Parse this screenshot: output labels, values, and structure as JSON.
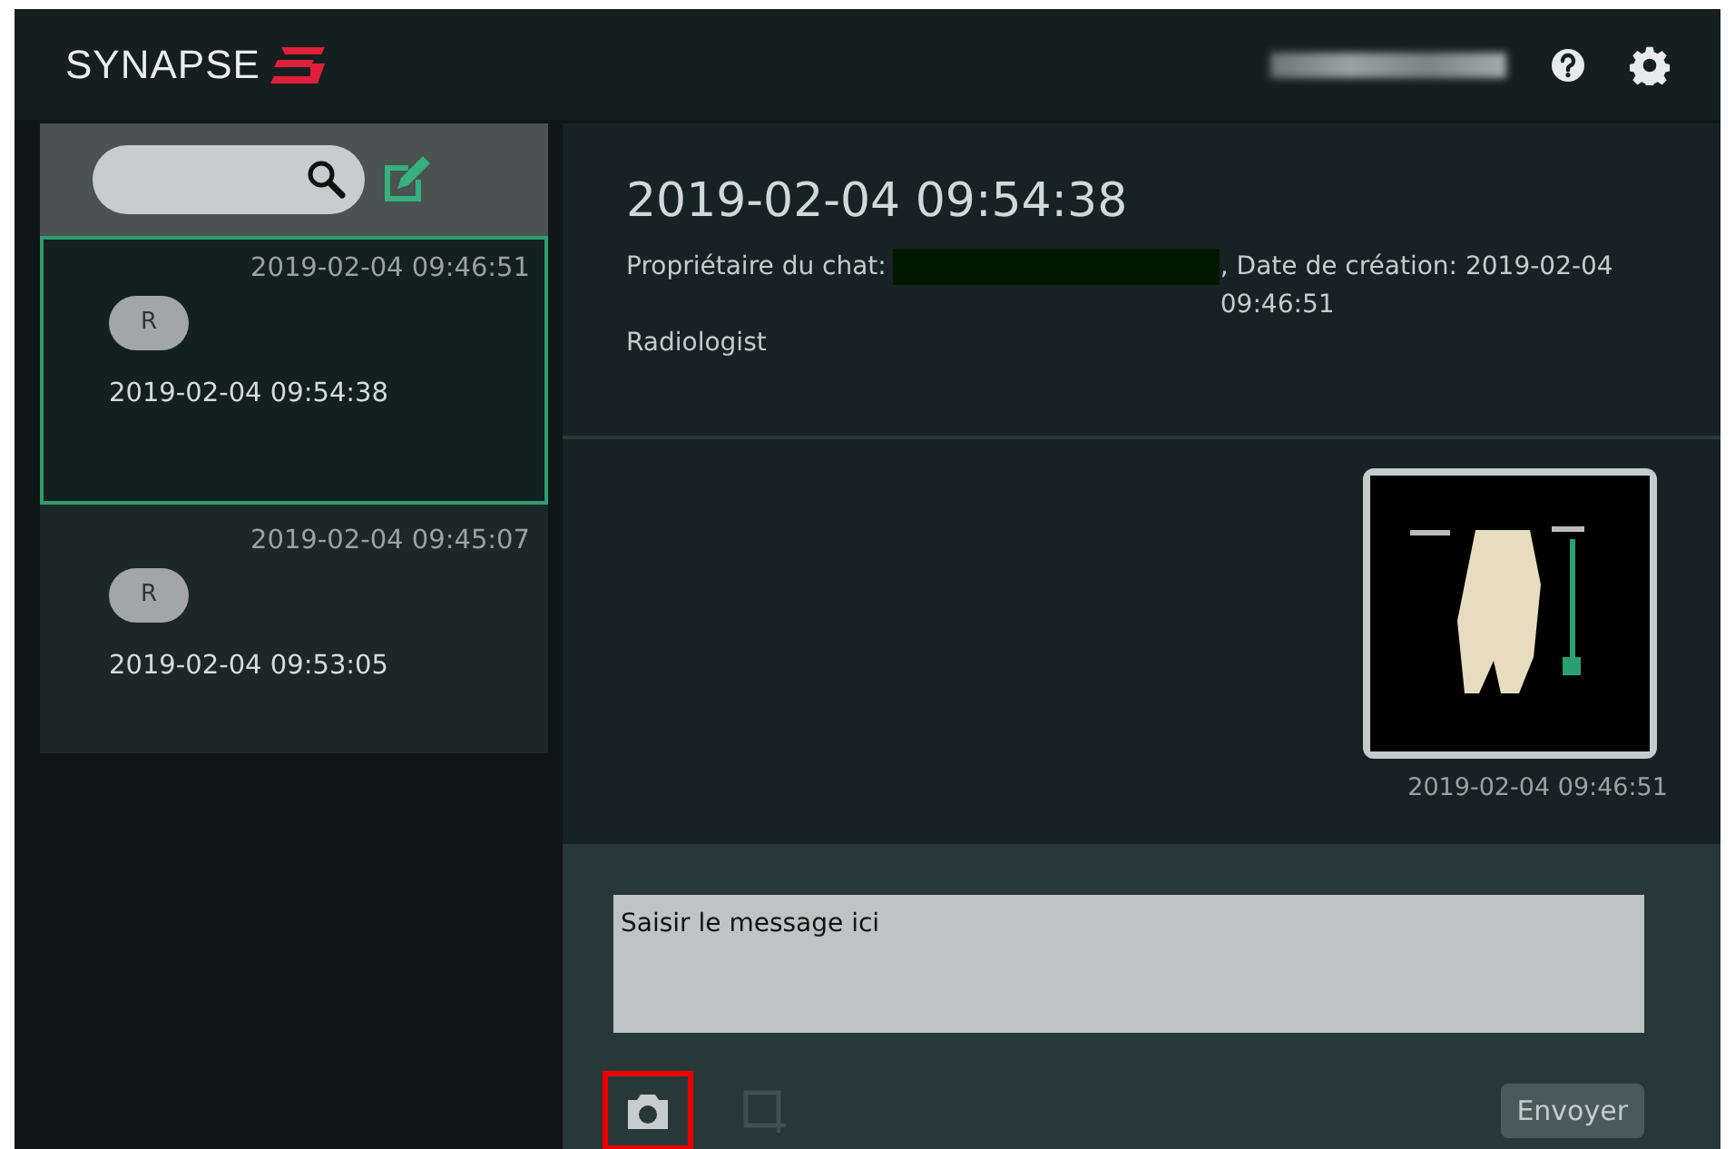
{
  "header": {
    "logo": "SYNAPSE"
  },
  "sidebar": {
    "chats": [
      {
        "created": "2019-02-04 09:46:51",
        "avatar": "R",
        "title": "2019-02-04 09:54:38",
        "selected": true
      },
      {
        "created": "2019-02-04 09:45:07",
        "avatar": "R",
        "title": "2019-02-04 09:53:05",
        "selected": false
      }
    ]
  },
  "chat": {
    "title": "2019-02-04 09:54:38",
    "owner_label": "Propriétaire du chat:",
    "creation": ", Date de création: 2019-02-04 09:46:51",
    "role": "Radiologist",
    "messages": [
      {
        "kind": "image",
        "time": "2019-02-04 09:46:51"
      }
    ]
  },
  "compose": {
    "value": "Saisir le message ici",
    "tools": [
      {
        "kind": "camera",
        "disabled": false,
        "highlighted": true
      },
      {
        "kind": "crop",
        "disabled": true,
        "highlighted": false
      }
    ],
    "send": "Envoyer"
  }
}
